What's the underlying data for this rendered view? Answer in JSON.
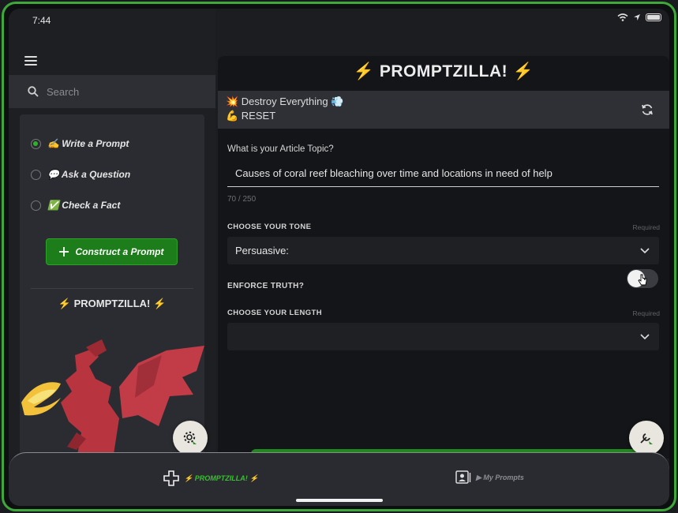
{
  "status": {
    "time": "7:44"
  },
  "sidebar": {
    "search_placeholder": "Search",
    "options": [
      {
        "label": "✍ Write a Prompt",
        "selected": true
      },
      {
        "label": "💬 Ask a Question",
        "selected": false
      },
      {
        "label": "✅ Check a Fact",
        "selected": false
      }
    ],
    "construct_label": "Construct a Prompt",
    "brand": "⚡ PROMPTZILLA! ⚡"
  },
  "main": {
    "brand": "⚡ PROMPTZILLA! ⚡",
    "destroy_label": "💥 Destroy Everything 💨",
    "reset_label": "💪 RESET",
    "topic_label": "What is your Article Topic?",
    "topic_value": "Causes of coral reef bleaching over time and locations in need of help",
    "topic_counter": "70 / 250",
    "tone_label": "CHOOSE YOUR TONE",
    "tone_required": "Required",
    "tone_value": "Persuasive:",
    "enforce_label": "ENFORCE TRUTH?",
    "enforce_on": false,
    "length_label": "CHOOSE YOUR LENGTH",
    "length_required": "Required",
    "length_value": ""
  },
  "tabbar": {
    "tab1_label": "⚡ PROMPTZILLA! ⚡",
    "tab2_label": "▶ My Prompts"
  },
  "colors": {
    "accent": "#1c7d1a",
    "border": "#3fa83a"
  }
}
